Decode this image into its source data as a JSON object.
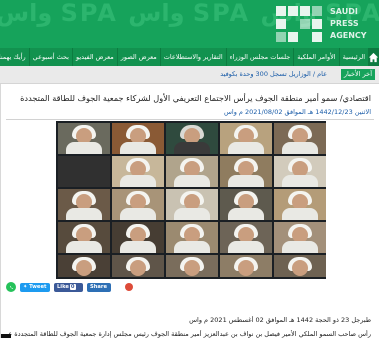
{
  "header": {
    "ghost_text": "واس SPA واس SPA واس SPA",
    "logo_text": "SAUDI PRESS AGENCY"
  },
  "nav": {
    "home_label": "الرئيسية",
    "items": [
      "الأوامر الملكية",
      "جلسات مجلس الوزراء",
      "التقارير والاستطلاعات",
      "معرض الصور",
      "معرض الفيديو",
      "بحث أسبوعي",
      "رأيك يهمنا",
      "ا"
    ]
  },
  "ticker": {
    "label": "آخر الأخبار",
    "news": "عام / الوزاريل تسجل 300 وحدة بكوفيد"
  },
  "article": {
    "title": "اقتصادي/ سمو أمير منطقة الجوف يرأس الاجتماع التعريفي الأول لشركاء جمعية الجوف للطاقة المتجددة",
    "dateline": "الاثنين 1442/12/23 هـ الموافق 2021/08/02 م واس",
    "body_line1": "طبرجل 23 ذو الحجة 1442 هـ الموافق 02 أغسطس 2021 م واس",
    "body_line2": "رأس صاحب السمو الملكي الأمير فيصل بن نواف بن عبدالعزيز أمير منطقة الجوف رئيس مجلس إدارة جمعية الجوف للطاقة المتجددة عبر"
  },
  "share": {
    "tweet_label": "Tweet",
    "like_label": "Like",
    "like_count": "0",
    "share_label": "Share"
  },
  "colors": {
    "brand_green": "#16a35b",
    "nav_green": "#12924f",
    "link_blue": "#1a5ca8"
  }
}
